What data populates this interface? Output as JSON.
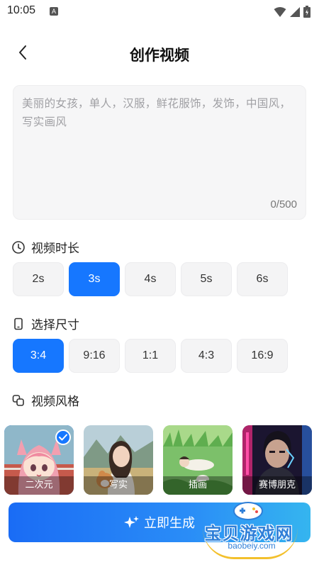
{
  "status_bar": {
    "time": "10:05",
    "notif_letter": "A"
  },
  "header": {
    "title": "创作视频"
  },
  "prompt": {
    "placeholder": "美丽的女孩，单人，汉服，鲜花服饰，发饰，中国风，写实画风",
    "counter": "0/500"
  },
  "duration": {
    "label": "视频时长",
    "options": [
      "2s",
      "3s",
      "4s",
      "5s",
      "6s"
    ],
    "selected": "3s"
  },
  "size": {
    "label": "选择尺寸",
    "options": [
      "3:4",
      "9:16",
      "1:1",
      "4:3",
      "16:9"
    ],
    "selected": "3:4"
  },
  "style": {
    "label": "视频风格",
    "options": [
      "二次元",
      "写实",
      "插画",
      "赛博朋克"
    ],
    "selected": "二次元"
  },
  "generate_button": {
    "label": "立即生成"
  },
  "watermark": {
    "text": "宝贝游戏网",
    "url": "baobeiy.com"
  },
  "colors": {
    "accent": "#1677ff",
    "chip_bg": "#f4f4f5",
    "placeholder": "#a0a0a4"
  }
}
